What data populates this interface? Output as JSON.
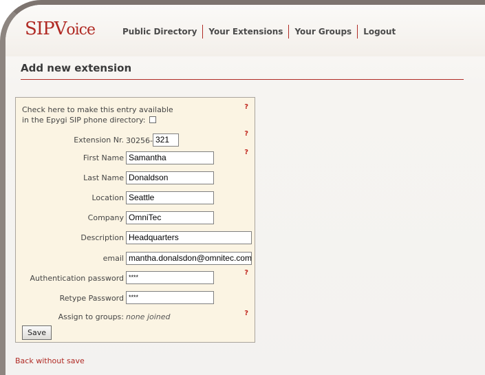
{
  "brand": {
    "logo_text": "SIPVoice",
    "accent_color": "#b02a24"
  },
  "nav": {
    "items": [
      "Public Directory",
      "Your Extensions",
      "Your Groups",
      "Logout"
    ]
  },
  "section": {
    "title": "Add new extension"
  },
  "form": {
    "directory_text_line1": "Check here to make this entry available",
    "directory_text_line2": "in the Epygi SIP phone directory:",
    "directory_checked": false,
    "help_mark": "?",
    "extension": {
      "label": "Extension Nr.",
      "prefix": "30256-",
      "value": "321"
    },
    "first_name": {
      "label": "First Name",
      "value": "Samantha"
    },
    "last_name": {
      "label": "Last Name",
      "value": "Donaldson"
    },
    "location": {
      "label": "Location",
      "value": "Seattle"
    },
    "company": {
      "label": "Company",
      "value": "OmniTec"
    },
    "description": {
      "label": "Description",
      "value": "Headquarters"
    },
    "email": {
      "label": "email",
      "value": "mantha.donalsdon@omnitec.com"
    },
    "auth_password": {
      "label": "Authentication password",
      "value": "****"
    },
    "retype_password": {
      "label": "Retype Password",
      "value": "****"
    },
    "groups": {
      "label": "Assign to groups:",
      "value": "none joined"
    },
    "save_label": "Save"
  },
  "back_link": "Back without save"
}
